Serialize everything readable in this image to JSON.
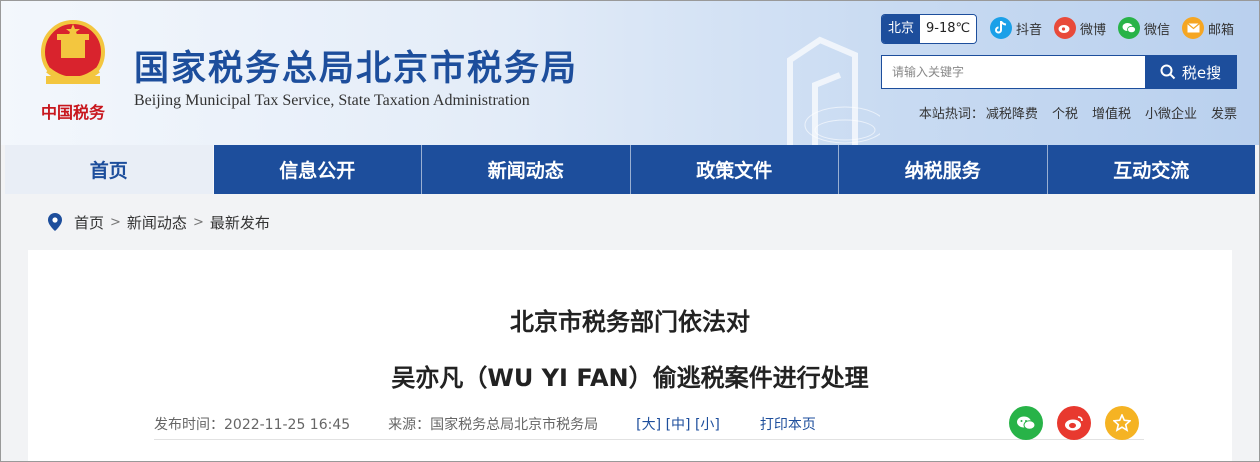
{
  "header": {
    "title": "国家税务总局北京市税务局",
    "subtitle": "Beijing Municipal Tax Service, State Taxation Administration",
    "emblem_text": "中国税务",
    "weather": {
      "city": "北京",
      "temp": "9-18℃"
    },
    "social": [
      {
        "icon": "douyin-icon",
        "label": "抖音",
        "color": "#1ba0e8"
      },
      {
        "icon": "weibo-icon",
        "label": "微博",
        "color": "#e84a3a"
      },
      {
        "icon": "wechat-icon",
        "label": "微信",
        "color": "#28b348"
      },
      {
        "icon": "mail-icon",
        "label": "邮箱",
        "color": "#f5a623"
      }
    ],
    "search": {
      "placeholder": "请输入关键字",
      "button_label": "税e搜"
    },
    "hot": {
      "label": "本站热词：",
      "keywords": [
        "减税降费",
        "个税",
        "增值税",
        "小微企业",
        "发票"
      ]
    }
  },
  "nav": {
    "items": [
      "首页",
      "信息公开",
      "新闻动态",
      "政策文件",
      "纳税服务",
      "互动交流"
    ],
    "active_index": 0
  },
  "breadcrumb": [
    "首页",
    "新闻动态",
    "最新发布"
  ],
  "article": {
    "title_line1": "北京市税务部门依法对",
    "title_line2": "吴亦凡（WU YI FAN）偷逃税案件进行处理",
    "publish_time": "发布时间：2022-11-25 16:45",
    "source": "来源：国家税务总局北京市税务局",
    "font_sizes": [
      "[大]",
      "[中]",
      "[小]"
    ],
    "print_label": "打印本页"
  },
  "share": [
    {
      "icon": "wechat-share-icon",
      "color": "#28b348"
    },
    {
      "icon": "weibo-share-icon",
      "color": "#e8392f"
    },
    {
      "icon": "favorite-star-icon",
      "color": "#f5b323"
    }
  ],
  "colors": {
    "brand": "#1d4e9c",
    "background": "#f2f3f5"
  }
}
